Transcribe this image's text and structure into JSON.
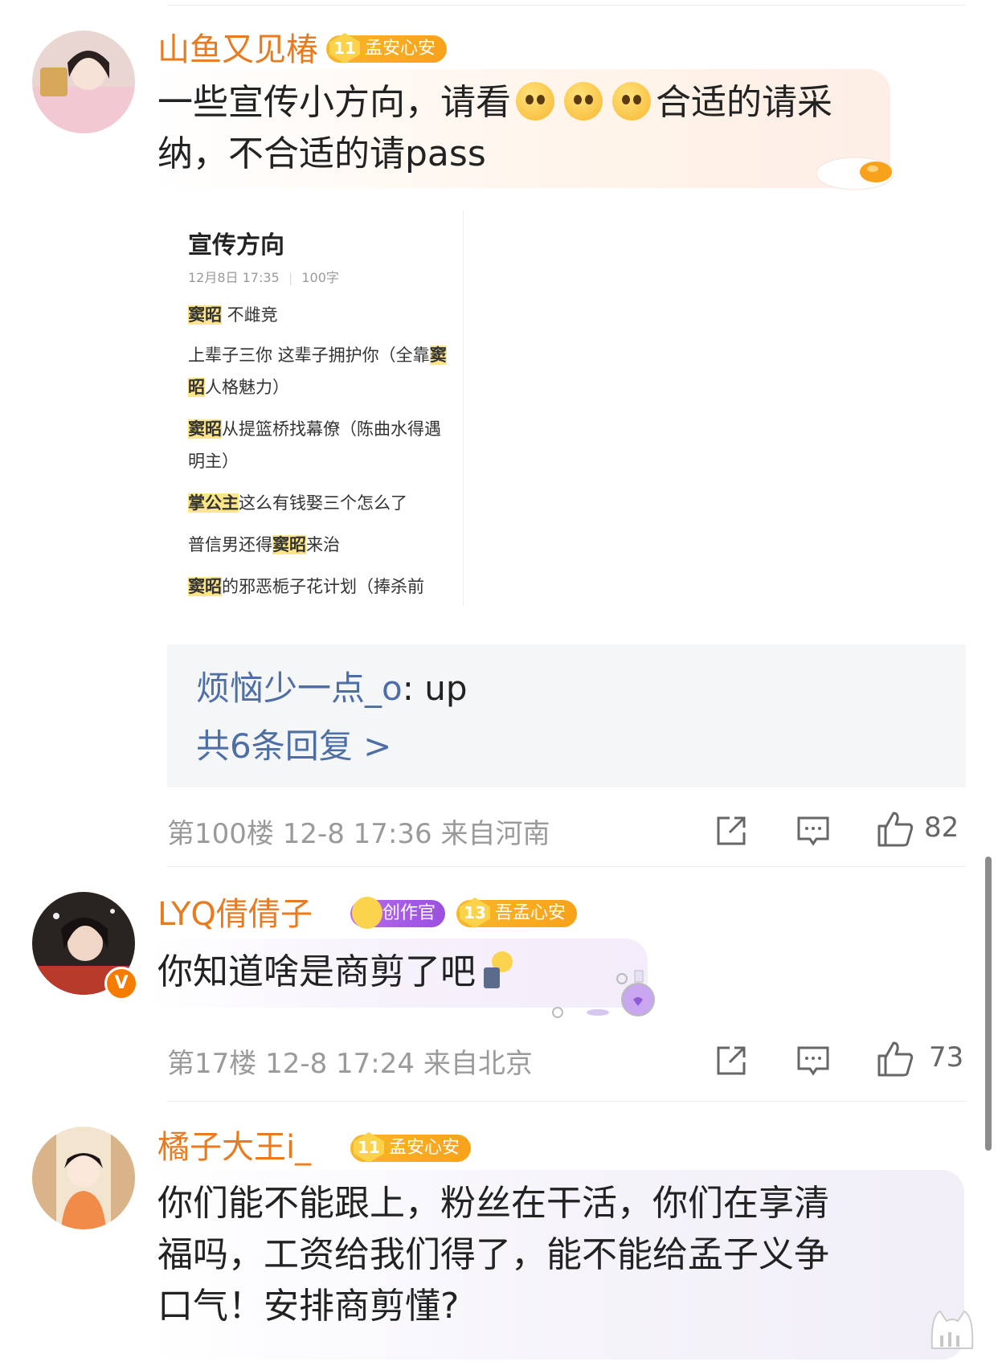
{
  "comments": [
    {
      "username": "山鱼又见椿",
      "fan_badge": {
        "level": "11",
        "label": "孟安心安"
      },
      "text_parts": [
        "一些宣传小方向，请看",
        "合适的请采纳，不合适的请pass"
      ],
      "note": {
        "title": "宣传方向",
        "date": "12月8日 17:35",
        "wordcount": "100字",
        "lines": [
          {
            "hl": "窦昭",
            "rest": " 不雌竞"
          },
          {
            "pre": "上辈子三你 这辈子拥护你（全靠",
            "hl": "窦昭",
            "rest": "人格魅力）"
          },
          {
            "hl": "窦昭",
            "rest": "从提篮桥找幕僚（陈曲水得遇明主）"
          },
          {
            "hl": "掌公主",
            "rest": "这么有钱娶三个怎么了"
          },
          {
            "pre": "普信男还得",
            "hl": "窦昭",
            "rest": "来治"
          },
          {
            "hl": "窦昭",
            "rest": "的邪恶栀子花计划（捧杀前"
          }
        ]
      },
      "reply": {
        "name": "烦恼少一点_o",
        "text": ": up",
        "more": "共6条回复 >"
      },
      "meta": "第100楼 12-8 17:36 来自河南",
      "likes": "82"
    },
    {
      "username": "LYQ倩倩子",
      "creator_badge": "创作官",
      "fan_badge": {
        "level": "13",
        "label": "吾孟心安"
      },
      "text": "你知道啥是商剪了吧",
      "meta": "第17楼 12-8 17:24 来自北京",
      "likes": "73"
    },
    {
      "username": "橘子大王i_",
      "fan_badge": {
        "level": "11",
        "label": "孟安心安"
      },
      "text_lines": [
        "你们能不能跟上，粉丝在干活，你们在享清",
        "福吗，工资给我们得了，能不能给孟子义争",
        "口气！安排商剪懂?"
      ]
    }
  ],
  "colors": {
    "username": "#e87a1f",
    "reply_link": "#4d6fa6",
    "badge": "#f7a21a",
    "meta": "#9a9a9a"
  }
}
